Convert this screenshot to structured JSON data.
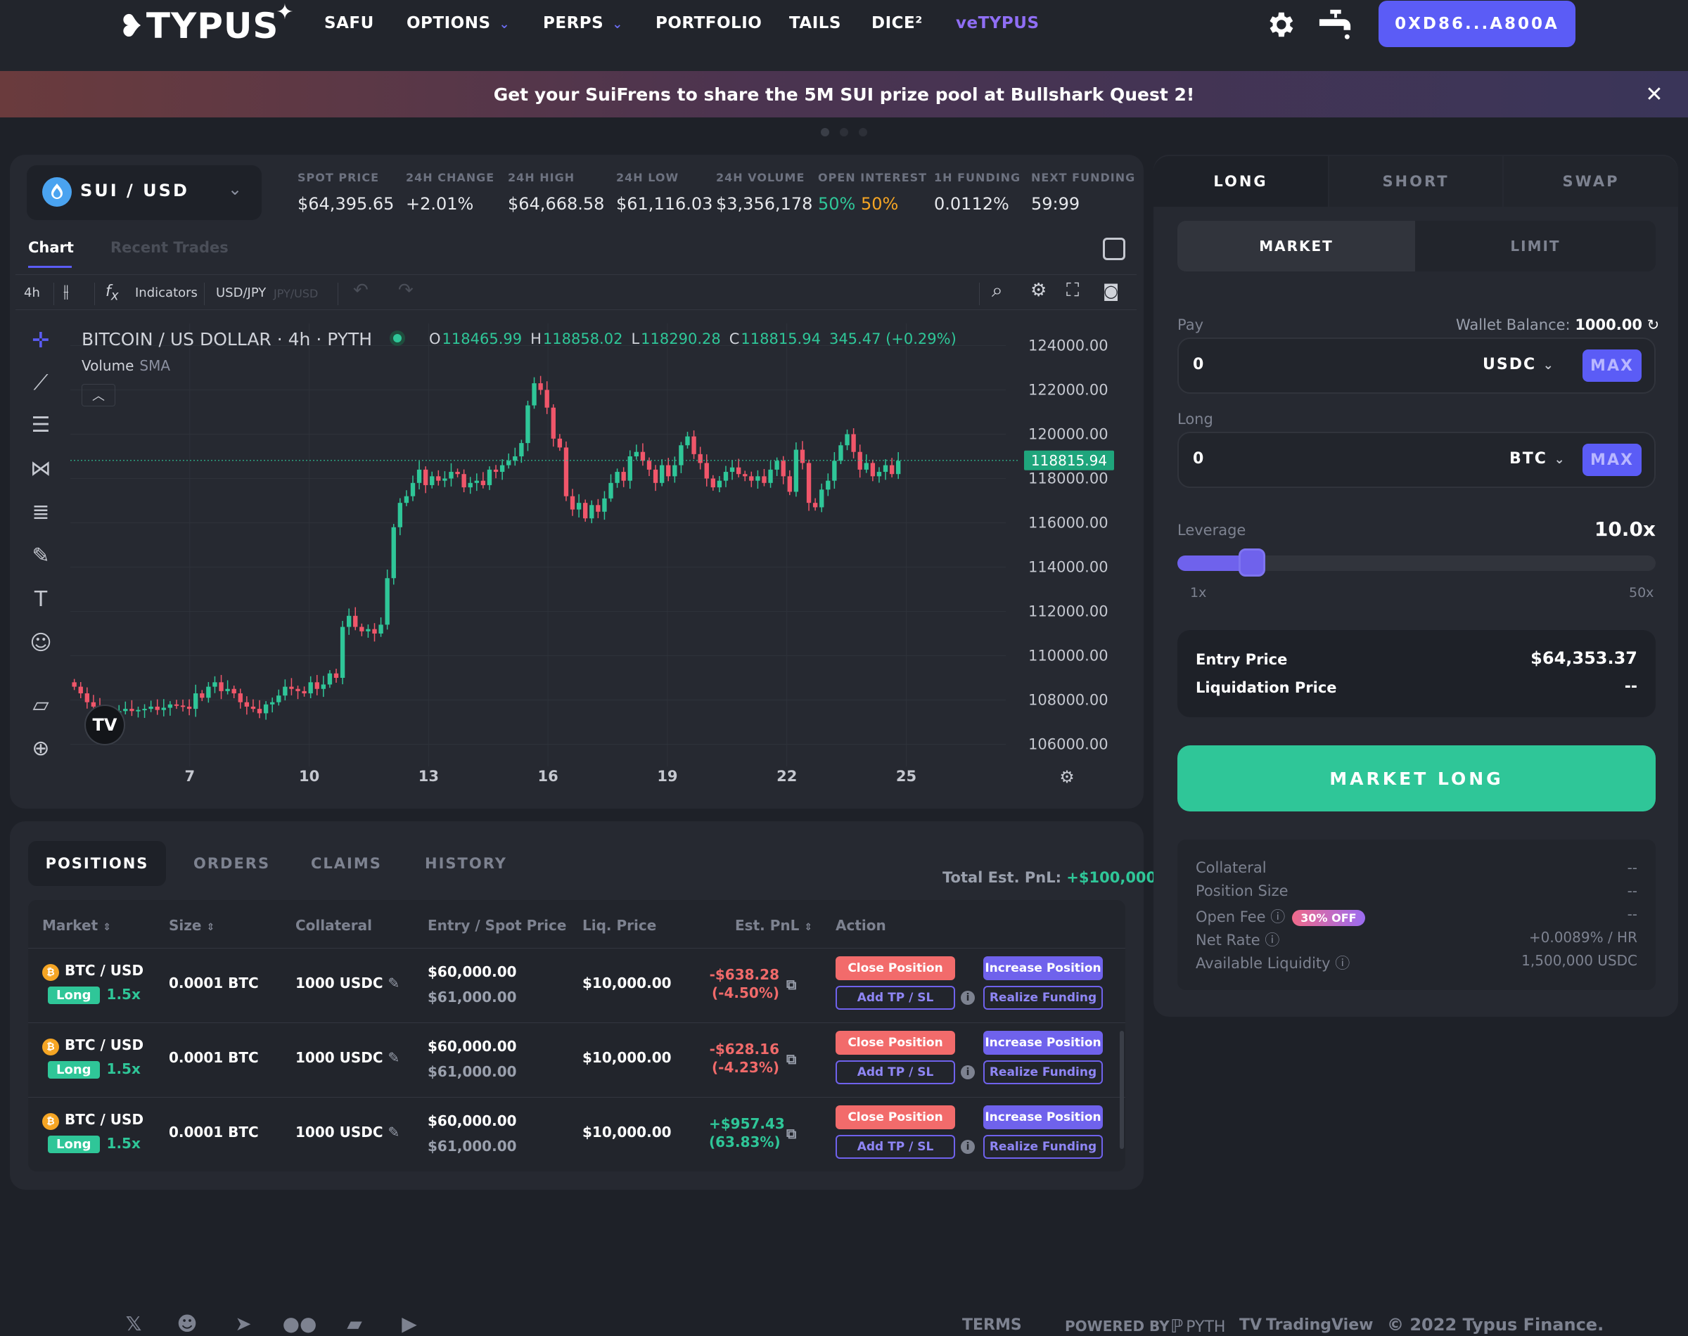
{
  "nav": {
    "logo": "TYPUS",
    "links": [
      "SAFU",
      "OPTIONS",
      "PERPS",
      "PORTFOLIO",
      "TAILS",
      "DICE²",
      "veTYPUS"
    ],
    "wallet": "0XD86...A800A"
  },
  "banner": {
    "text": "Get your SuiFrens to share the 5M SUI prize pool at Bullshark Quest 2!"
  },
  "market": {
    "pair": "SUI / USD",
    "stats": [
      {
        "label": "SPOT PRICE",
        "value": "$64,395.65"
      },
      {
        "label": "24H CHANGE",
        "value": "+2.01%"
      },
      {
        "label": "24H HIGH",
        "value": "$64,668.58"
      },
      {
        "label": "24H LOW",
        "value": "$61,116.03"
      },
      {
        "label": "24H VOLUME",
        "value": "$3,356,178"
      },
      {
        "label": "OPEN INTEREST",
        "value_long": "50%",
        "value_short": "50%"
      },
      {
        "label": "1H FUNDING",
        "value": "0.0112%"
      },
      {
        "label": "NEXT FUNDING",
        "value": "59:99"
      }
    ]
  },
  "chart_tabs": [
    "Chart",
    "Recent Trades"
  ],
  "toolbar": {
    "interval": "4h",
    "indicators": "Indicators",
    "symbol_a": "USD/JPY",
    "symbol_b": "JPY/USD"
  },
  "chart_data": {
    "type": "candlestick",
    "title": "BITCOIN / US DOLLAR · 4h · PYTH",
    "legend_volume": "Volume",
    "legend_sma": "SMA",
    "ohlc": {
      "o": "118465.99",
      "h": "118858.02",
      "l": "118290.28",
      "c": "118815.94",
      "change": "345.47 (+0.29%)"
    },
    "last_price_label": "118815.94",
    "last_price": 118815.94,
    "ylim": [
      105000,
      125000
    ],
    "yticks": [
      "124000.00",
      "122000.00",
      "120000.00",
      "118000.00",
      "116000.00",
      "114000.00",
      "112000.00",
      "110000.00",
      "108000.00",
      "106000.00"
    ],
    "ytick_values": [
      124000,
      122000,
      120000,
      118000,
      116000,
      114000,
      112000,
      110000,
      108000,
      106000
    ],
    "xticks": [
      "7",
      "10",
      "13",
      "16",
      "19",
      "22",
      "25"
    ],
    "xtick_values": [
      7,
      10,
      13,
      16,
      19,
      22,
      25
    ],
    "xlim": [
      4,
      27.5
    ],
    "closes": [
      108600,
      108300,
      107900,
      107700,
      107300,
      107100,
      107400,
      107500,
      107600,
      107500,
      107550,
      107600,
      107700,
      107550,
      107650,
      107800,
      107750,
      107700,
      107600,
      108300,
      108100,
      108600,
      108800,
      108400,
      108500,
      108300,
      107900,
      107700,
      107600,
      107400,
      107800,
      107900,
      108200,
      108600,
      108500,
      108400,
      108300,
      108800,
      108500,
      108700,
      109200,
      109000,
      111300,
      111800,
      111300,
      111100,
      111200,
      111000,
      111400,
      113500,
      115800,
      116900,
      117200,
      117800,
      118400,
      117700,
      118100,
      117900,
      118000,
      118300,
      118200,
      117600,
      117800,
      117900,
      117700,
      118400,
      118300,
      118600,
      118800,
      119000,
      119600,
      121300,
      122300,
      122000,
      121200,
      119800,
      119400,
      117200,
      116600,
      116900,
      116200,
      116800,
      116500,
      117100,
      117800,
      118300,
      117900,
      119000,
      119200,
      118800,
      118400,
      117800,
      118600,
      118100,
      118600,
      119500,
      119900,
      119100,
      118700,
      118000,
      117600,
      117900,
      118300,
      118500,
      118200,
      118100,
      117900,
      118100,
      117800,
      118400,
      118800,
      118100,
      117400,
      119300,
      118700,
      116900,
      116700,
      117500,
      117900,
      118800,
      119500,
      120000,
      119200,
      118400,
      118700,
      118100,
      118300,
      118600,
      118200,
      118800
    ]
  },
  "positions": {
    "tabs": [
      "POSITIONS",
      "ORDERS",
      "CLAIMS",
      "HISTORY"
    ],
    "total_pnl_label": "Total Est. PnL:",
    "total_pnl_value": "+$100,000",
    "headers": [
      "Market",
      "Size",
      "Collateral",
      "Entry",
      "Spot Price",
      "Liq. Price",
      "Est. PnL",
      "Action"
    ],
    "rows": [
      {
        "market": "BTC / USD",
        "side": "Long",
        "lev": "1.5x",
        "size": "0.0001 BTC",
        "collateral": "1000 USDC",
        "entry": "$60,000.00",
        "spot": "$61,000.00",
        "liq": "$10,000.00",
        "pnl": "-$638.28",
        "pnl_pct": "(-4.50%)",
        "pnl_color": "#f06a6a"
      },
      {
        "market": "BTC / USD",
        "side": "Long",
        "lev": "1.5x",
        "size": "0.0001 BTC",
        "collateral": "1000 USDC",
        "entry": "$60,000.00",
        "spot": "$61,000.00",
        "liq": "$10,000.00",
        "pnl": "-$628.16",
        "pnl_pct": "(-4.23%)",
        "pnl_color": "#f06a6a"
      },
      {
        "market": "BTC / USD",
        "side": "Long",
        "lev": "1.5x",
        "size": "0.0001 BTC",
        "collateral": "1000 USDC",
        "entry": "$60,000.00",
        "spot": "$61,000.00",
        "liq": "$10,000.00",
        "pnl": "+$957.43",
        "pnl_pct": "(63.83%)",
        "pnl_color": "#2fc698"
      }
    ],
    "actions": {
      "close": "Close Position",
      "increase": "Increase Position",
      "tpsl": "Add TP / SL",
      "funding": "Realize Funding"
    }
  },
  "trade": {
    "tabs": [
      "LONG",
      "SHORT",
      "SWAP"
    ],
    "order_tabs": [
      "MARKET",
      "LIMIT"
    ],
    "pay_label": "Pay",
    "wallet_balance_label": "Wallet Balance:",
    "wallet_balance_value": "1000.00",
    "pay_value": "0",
    "pay_token": "USDC",
    "long_label": "Long",
    "long_value": "0",
    "long_token": "BTC",
    "max": "MAX",
    "leverage_label": "Leverage",
    "leverage_value": "10.0x",
    "leverage_level": 0.184,
    "lev_min": "1x",
    "lev_max": "50x",
    "entry_price_label": "Entry Price",
    "entry_price": "$64,353.37",
    "liq_price_label": "Liquidation Price",
    "liq_price": "--",
    "submit": "MARKET LONG",
    "details": [
      {
        "label": "Collateral",
        "value": "--"
      },
      {
        "label": "Position Size",
        "value": "--"
      },
      {
        "label": "Open Fee",
        "value": "--",
        "badge": "30% OFF"
      },
      {
        "label": "Net Rate",
        "value": "+0.0089% / HR"
      },
      {
        "label": "Available Liquidity",
        "value": "1,500,000 USDC"
      }
    ]
  },
  "footer": {
    "terms": "TERMS",
    "powered_by": "POWERED BY",
    "pyth": "PYTH",
    "tradingview": "TradingView",
    "copyright": "© 2022 Typus Finance."
  },
  "colors": {
    "accent": "#5b5cf6",
    "green": "#2fc698",
    "red": "#f06a6a",
    "background": "#1e2128",
    "panel": "#262931"
  }
}
